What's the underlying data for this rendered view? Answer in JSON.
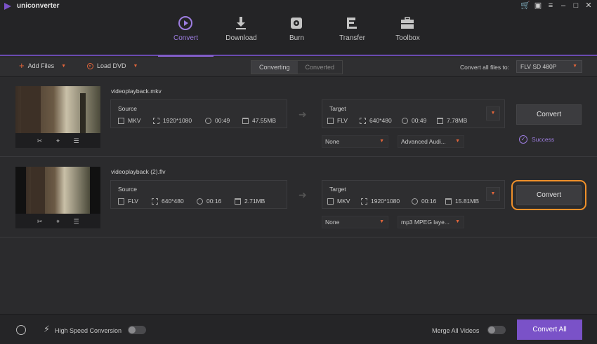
{
  "app": {
    "title": "uniconverter"
  },
  "window_controls": [
    "cart-icon",
    "gift-icon",
    "menu-icon",
    "minimize-icon",
    "maximize-icon",
    "close-icon"
  ],
  "nav": [
    {
      "label": "Convert",
      "icon": "convert-icon",
      "active": true
    },
    {
      "label": "Download",
      "icon": "download-icon",
      "active": false
    },
    {
      "label": "Burn",
      "icon": "burn-icon",
      "active": false
    },
    {
      "label": "Transfer",
      "icon": "transfer-icon",
      "active": false
    },
    {
      "label": "Toolbox",
      "icon": "toolbox-icon",
      "active": false
    }
  ],
  "toolbar": {
    "add_files": "Add Files",
    "load_dvd": "Load DVD",
    "tab_converting": "Converting",
    "tab_converted": "Converted",
    "convert_all_to_label": "Convert all files to:",
    "convert_all_to_value": "FLV SD 480P"
  },
  "files": [
    {
      "name": "videoplayback.mkv",
      "source": {
        "title": "Source",
        "format": "MKV",
        "resolution": "1920*1080",
        "duration": "00:49",
        "size": "47.55MB"
      },
      "target": {
        "title": "Target",
        "format": "FLV",
        "resolution": "640*480",
        "duration": "00:49",
        "size": "7.78MB"
      },
      "subtitle": "None",
      "audio": "Advanced Audi...",
      "button": "Convert",
      "status": "Success"
    },
    {
      "name": "videoplayback (2).flv",
      "source": {
        "title": "Source",
        "format": "FLV",
        "resolution": "640*480",
        "duration": "00:16",
        "size": "2.71MB"
      },
      "target": {
        "title": "Target",
        "format": "MKV",
        "resolution": "1920*1080",
        "duration": "00:16",
        "size": "15.81MB"
      },
      "subtitle": "None",
      "audio": "mp3 MPEG laye...",
      "button": "Convert",
      "status": ""
    }
  ],
  "bottom": {
    "high_speed_label": "High Speed Conversion",
    "merge_label": "Merge All Videos",
    "convert_all": "Convert All"
  },
  "colors": {
    "accent": "#7a52c8",
    "orange": "#e0643a",
    "highlight": "#f0902a"
  }
}
